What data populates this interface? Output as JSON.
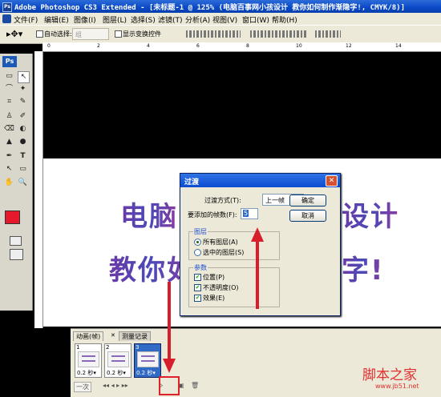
{
  "title": "Adobe Photoshop CS3 Extended - [未标题-1 @ 125% (电脑百事网小孩设计 教你如何制作渐隐字!, CMYK/8)]",
  "menu": [
    "文件(F)",
    "编辑(E)",
    "图像(I)",
    "图层(L)",
    "选择(S)",
    "滤镜(T)",
    "分析(A)",
    "视图(V)",
    "窗口(W)",
    "帮助(H)"
  ],
  "options": {
    "auto_select": "自动选择:",
    "auto_select_value": "组",
    "show_transform": "显示变换控件"
  },
  "toolbox": {
    "logo": "Ps",
    "tool_glyphs": [
      "▭",
      "↖",
      "⌒",
      "✦",
      "⌗",
      "✎",
      "♙",
      "✐",
      "⌫",
      "◐",
      "▲",
      "●",
      "✒",
      "T",
      "↖",
      "▭",
      "✋",
      "🔍"
    ]
  },
  "ruler": {
    "h_ticks": [
      "0",
      "2",
      "4",
      "6",
      "8",
      "10",
      "12",
      "14"
    ]
  },
  "canvas": {
    "line1_left": "电脑",
    "line1_right": "设计",
    "line2_left": "教你如",
    "line2_right": "字!"
  },
  "dialog": {
    "title": "过渡",
    "method_label": "过渡方式(T):",
    "method_value": "上一帧",
    "frames_label": "要添加的帧数(F):",
    "frames_value": "5",
    "ok": "确定",
    "cancel": "取消",
    "layers_group": "图层",
    "all_layers": "所有图层(A)",
    "selected_layers": "选中的图层(S)",
    "params_group": "参数",
    "position": "位置(P)",
    "opacity": "不透明度(O)",
    "effects": "效果(E)"
  },
  "anim_panel": {
    "tab1": "动画(帧)",
    "tab2": "测量记录",
    "frames": [
      {
        "num": "1",
        "delay": "0.2 秒▾",
        "selected": false
      },
      {
        "num": "2",
        "delay": "0.2 秒▾",
        "selected": false
      },
      {
        "num": "3",
        "delay": "0.2 秒▾",
        "selected": true
      }
    ],
    "loop": "一次",
    "controls": "◂◂ ◂ ▸ ▸▸"
  },
  "watermark": {
    "text": "脚本之家",
    "url": "www.jb51.net"
  },
  "colors": {
    "arrow": "#d81e2a",
    "foreground": "#e5192b"
  }
}
